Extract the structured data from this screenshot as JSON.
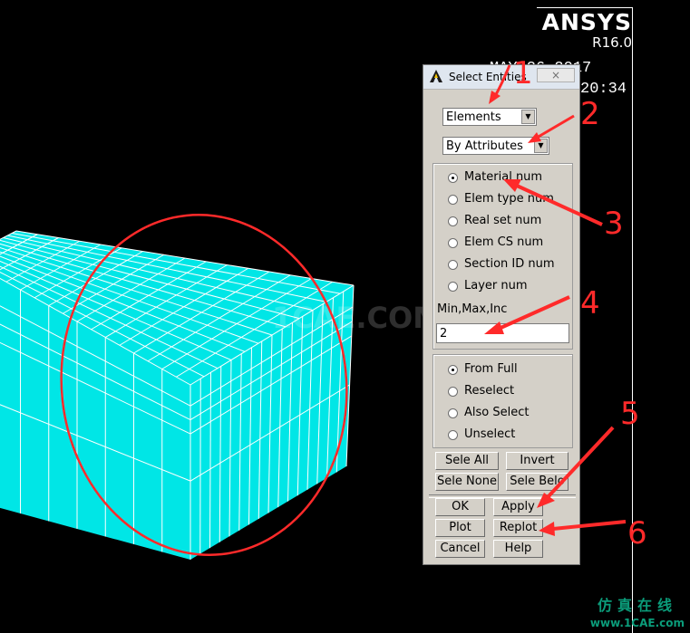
{
  "viewport": {
    "brand": "ANSYS",
    "version": "R16.0",
    "date_partial": "MAY 26 2017",
    "time_partial": "20:34",
    "watermark": "1CAE.COM",
    "site_cn": "仿真在线",
    "site": "www.1CAE.com"
  },
  "dialog": {
    "title": "Select Entities",
    "close_symbol": "×",
    "entity_type": "Elements",
    "criterion": "By Attributes",
    "attributes": [
      {
        "label": "Material num",
        "selected": true
      },
      {
        "label": "Elem type num",
        "selected": false
      },
      {
        "label": "Real set num",
        "selected": false
      },
      {
        "label": "Elem CS num",
        "selected": false
      },
      {
        "label": "Section ID num",
        "selected": false
      },
      {
        "label": "Layer num",
        "selected": false
      }
    ],
    "min_max_label": "Min,Max,Inc",
    "min_max_value": "2",
    "select_modes": [
      {
        "label": "From Full",
        "selected": true
      },
      {
        "label": "Reselect",
        "selected": false
      },
      {
        "label": "Also Select",
        "selected": false
      },
      {
        "label": "Unselect",
        "selected": false
      }
    ],
    "buttons": {
      "sele_all": "Sele All",
      "invert": "Invert",
      "sele_none": "Sele None",
      "sele_belo": "Sele Belo",
      "ok": "OK",
      "apply": "Apply",
      "plot": "Plot",
      "replot": "Replot",
      "cancel": "Cancel",
      "help": "Help"
    }
  },
  "annotations": [
    "1",
    "2",
    "3",
    "4",
    "5",
    "6"
  ],
  "colors": {
    "mesh": "#00e6e6",
    "annotation": "#ff2a2a",
    "dialog_bg": "#d4d0c8"
  }
}
